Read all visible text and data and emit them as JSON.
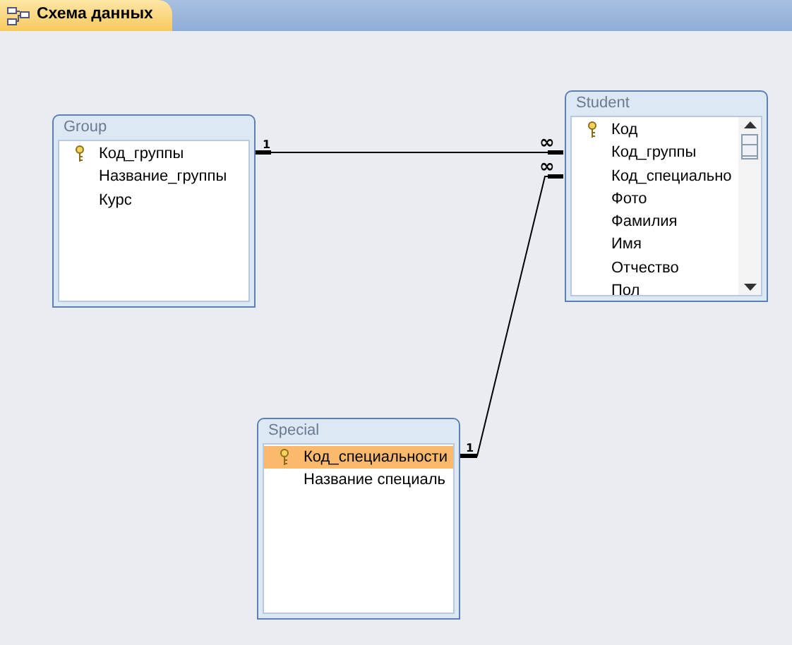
{
  "tab": {
    "title": "Схема данных",
    "selected": true
  },
  "tables": [
    {
      "name": "Group",
      "scrollbar": false,
      "fields": [
        {
          "name": "Код_группы",
          "key": true,
          "selected": false
        },
        {
          "name": "Название_группы",
          "key": false,
          "selected": false
        },
        {
          "name": "Курс",
          "key": false,
          "selected": false
        }
      ]
    },
    {
      "name": "Student",
      "scrollbar": true,
      "fields": [
        {
          "name": "Код",
          "key": true,
          "selected": false
        },
        {
          "name": "Код_группы",
          "key": false,
          "selected": false
        },
        {
          "name": "Код_специально",
          "key": false,
          "selected": false
        },
        {
          "name": "Фото",
          "key": false,
          "selected": false
        },
        {
          "name": "Фамилия",
          "key": false,
          "selected": false
        },
        {
          "name": "Имя",
          "key": false,
          "selected": false
        },
        {
          "name": "Отчество",
          "key": false,
          "selected": false
        },
        {
          "name": "Пол",
          "key": false,
          "selected": false
        }
      ]
    },
    {
      "name": "Special",
      "scrollbar": false,
      "fields": [
        {
          "name": "Код_специальности",
          "key": true,
          "selected": true
        },
        {
          "name": "Название специаль",
          "key": false,
          "selected": false
        }
      ]
    }
  ],
  "relationships": [
    {
      "one_label": "1",
      "many_label": "∞"
    },
    {
      "one_label": "1",
      "many_label": "∞"
    }
  ]
}
